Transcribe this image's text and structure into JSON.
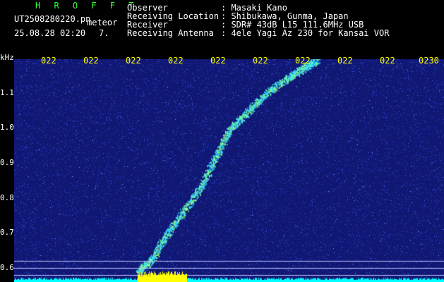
{
  "header": {
    "station": "H R O F F T",
    "filename": "UT2508280220.pn",
    "event_type": "meteor",
    "datetime": "25.08.28 02:20",
    "minute_marker": "7.",
    "info_keys": [
      "Observer",
      "Receiving Location",
      "Receiver",
      "Receiving Antenna"
    ],
    "info_values": [
      ": Masaki Kano",
      ": Shibukawa, Gunma, Japan",
      ": SDR# 43dB L15 111.6MHz USB",
      ": 4ele Yagi Az 230 for Kansai VOR"
    ]
  },
  "plot": {
    "y_unit": "kHz",
    "y_ticks": [
      "1.1",
      "1.0",
      "0.9",
      "0.8",
      "0.7",
      "0.6"
    ],
    "x_ticks": [
      "022",
      "022",
      "022",
      "022",
      "022",
      "022",
      "022",
      "022",
      "022",
      "0230"
    ],
    "colors": {
      "background": "#101874",
      "noise": "#2a44c8",
      "trace": "#33ddff",
      "trace_hot": "#88ff88",
      "floor": "#00ffff",
      "burst": "#ffff00",
      "ref_line": "#c0c0ff"
    }
  }
}
